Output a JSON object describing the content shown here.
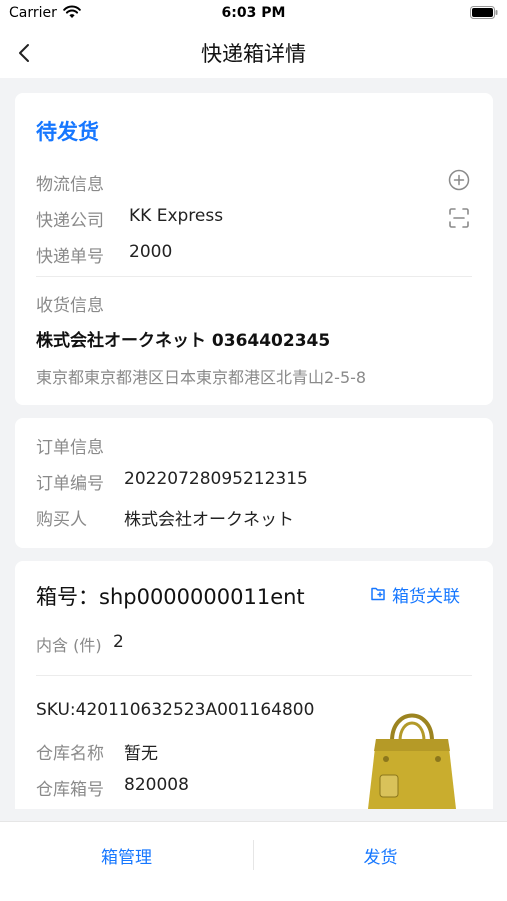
{
  "status_bar": {
    "carrier": "Carrier",
    "time": "6:03 PM"
  },
  "nav": {
    "title": "快递箱详情",
    "back_icon": "chevron-left-icon"
  },
  "shipment": {
    "status": "待发货",
    "logistics_label": "物流信息",
    "courier_label": "快递公司",
    "courier_value": "KK Express",
    "tracking_label": "快递单号",
    "tracking_value": "2000",
    "receiver_label": "收货信息",
    "receiver_name_phone": "株式会社オークネット 0364402345",
    "address": "東京都東京都港区日本東京都港区北青山2-5-8"
  },
  "order": {
    "section_label": "订单信息",
    "order_no_label": "订单编号",
    "order_no_value": "20220728095212315",
    "buyer_label": "购买人",
    "buyer_value": "株式会社オークネット"
  },
  "box": {
    "title": "箱号：shp0000000011ent",
    "link_label": "箱货关联",
    "contains_label": "内含 (件)",
    "contains_value": "2",
    "sku": "SKU:420110632523A001164800",
    "warehouse_name_label": "仓库名称",
    "warehouse_name_value": "暂无",
    "warehouse_box_label": "仓库箱号",
    "warehouse_box_value": "820008"
  },
  "tabs": {
    "left": "箱管理",
    "right": "发货"
  },
  "colors": {
    "accent": "#1677ff",
    "bag": "#c9ad2e"
  }
}
